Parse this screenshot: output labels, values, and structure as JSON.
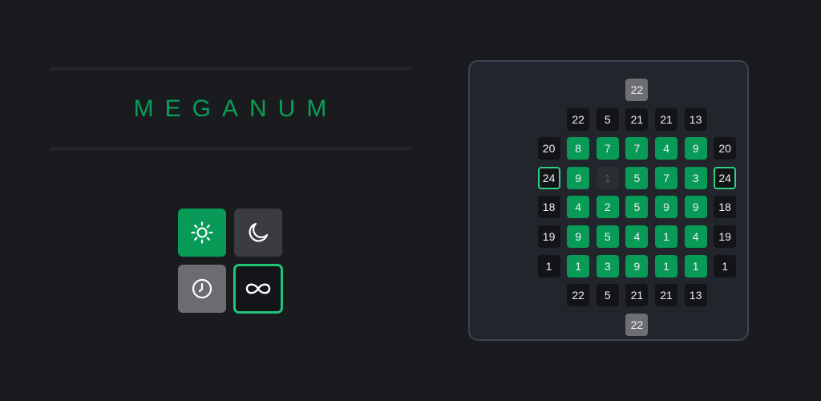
{
  "title": "MEGANUM",
  "colors": {
    "accent": "#0a9f57",
    "highlight": "#2fcf84",
    "background": "#1a1b1f"
  },
  "mode_buttons": [
    {
      "id": "light",
      "icon": "sun-icon",
      "selected": true
    },
    {
      "id": "dark",
      "icon": "moon-icon",
      "selected": false
    },
    {
      "id": "timed",
      "icon": "clock-icon",
      "selected": false
    },
    {
      "id": "infinite",
      "icon": "infinity-icon",
      "selected": true
    }
  ],
  "board": {
    "rows": [
      [
        {
          "c": 4,
          "v": "22",
          "t": "s"
        }
      ],
      [
        {
          "c": 2,
          "v": "22",
          "t": "k"
        },
        {
          "c": 3,
          "v": "5",
          "t": "k"
        },
        {
          "c": 4,
          "v": "21",
          "t": "k"
        },
        {
          "c": 5,
          "v": "21",
          "t": "k"
        },
        {
          "c": 6,
          "v": "13",
          "t": "k"
        }
      ],
      [
        {
          "c": 1,
          "v": "20",
          "t": "k"
        },
        {
          "c": 2,
          "v": "8",
          "t": "g"
        },
        {
          "c": 3,
          "v": "7",
          "t": "g"
        },
        {
          "c": 4,
          "v": "7",
          "t": "g"
        },
        {
          "c": 5,
          "v": "4",
          "t": "g"
        },
        {
          "c": 6,
          "v": "9",
          "t": "g"
        },
        {
          "c": 7,
          "v": "20",
          "t": "k"
        }
      ],
      [
        {
          "c": 1,
          "v": "24",
          "t": "o"
        },
        {
          "c": 2,
          "v": "9",
          "t": "g"
        },
        {
          "c": 3,
          "v": "1",
          "t": "d"
        },
        {
          "c": 4,
          "v": "5",
          "t": "g"
        },
        {
          "c": 5,
          "v": "7",
          "t": "g"
        },
        {
          "c": 6,
          "v": "3",
          "t": "g"
        },
        {
          "c": 7,
          "v": "24",
          "t": "o"
        }
      ],
      [
        {
          "c": 1,
          "v": "18",
          "t": "k"
        },
        {
          "c": 2,
          "v": "4",
          "t": "g"
        },
        {
          "c": 3,
          "v": "2",
          "t": "g"
        },
        {
          "c": 4,
          "v": "5",
          "t": "g"
        },
        {
          "c": 5,
          "v": "9",
          "t": "g"
        },
        {
          "c": 6,
          "v": "9",
          "t": "g"
        },
        {
          "c": 7,
          "v": "18",
          "t": "k"
        }
      ],
      [
        {
          "c": 1,
          "v": "19",
          "t": "k"
        },
        {
          "c": 2,
          "v": "9",
          "t": "g"
        },
        {
          "c": 3,
          "v": "5",
          "t": "g"
        },
        {
          "c": 4,
          "v": "4",
          "t": "g"
        },
        {
          "c": 5,
          "v": "1",
          "t": "g"
        },
        {
          "c": 6,
          "v": "4",
          "t": "g"
        },
        {
          "c": 7,
          "v": "19",
          "t": "k"
        }
      ],
      [
        {
          "c": 1,
          "v": "1",
          "t": "k"
        },
        {
          "c": 2,
          "v": "1",
          "t": "g"
        },
        {
          "c": 3,
          "v": "3",
          "t": "g"
        },
        {
          "c": 4,
          "v": "9",
          "t": "g"
        },
        {
          "c": 5,
          "v": "1",
          "t": "g"
        },
        {
          "c": 6,
          "v": "1",
          "t": "g"
        },
        {
          "c": 7,
          "v": "1",
          "t": "k"
        }
      ],
      [
        {
          "c": 2,
          "v": "22",
          "t": "k"
        },
        {
          "c": 3,
          "v": "5",
          "t": "k"
        },
        {
          "c": 4,
          "v": "21",
          "t": "k"
        },
        {
          "c": 5,
          "v": "21",
          "t": "k"
        },
        {
          "c": 6,
          "v": "13",
          "t": "k"
        }
      ],
      [
        {
          "c": 4,
          "v": "22",
          "t": "s"
        }
      ]
    ]
  }
}
